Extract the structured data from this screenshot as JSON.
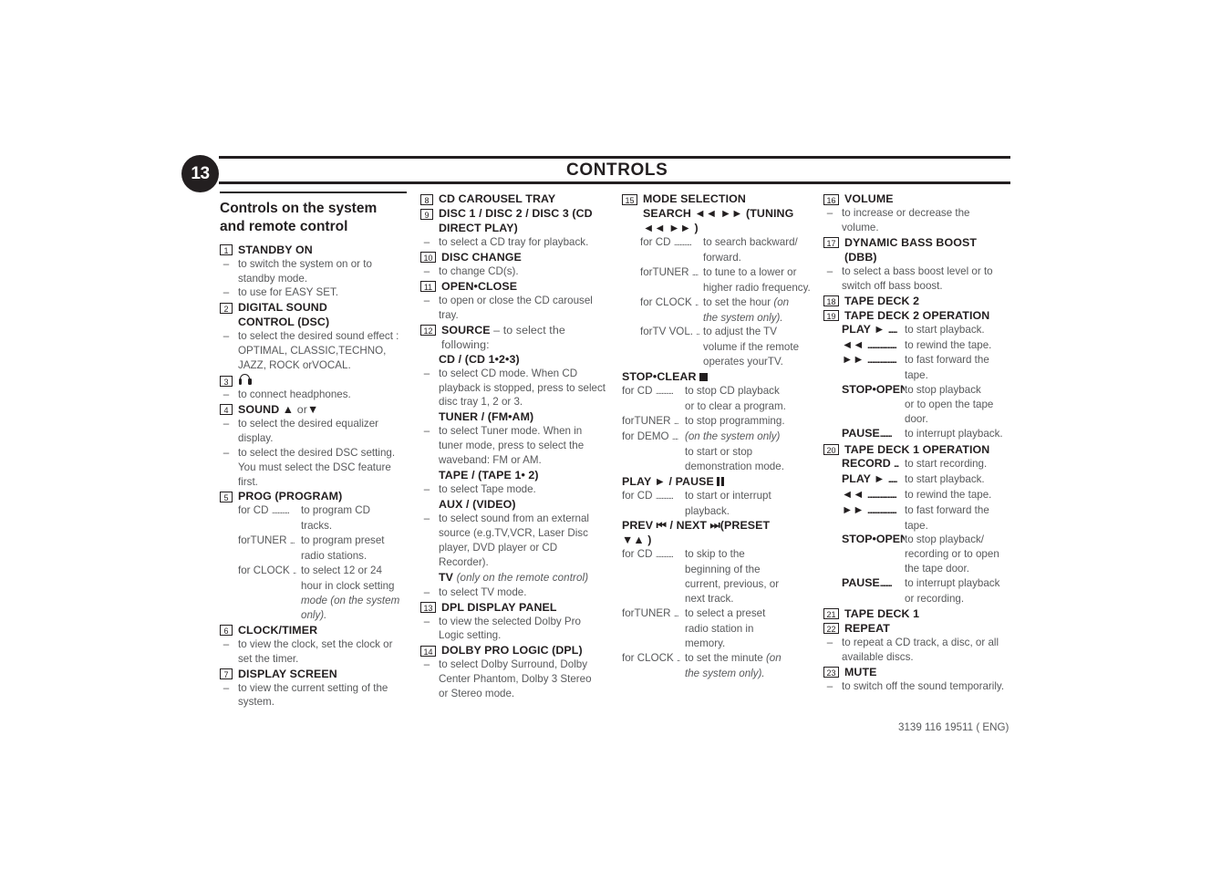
{
  "page": {
    "number": "13",
    "header_title": "CONTROLS",
    "footer_code": "3139 116 19511 ( ENG)"
  },
  "column1": {
    "section_title_line1": "Controls on the system",
    "section_title_line2": "and remote control",
    "items": [
      {
        "num": "1",
        "label": "STANDBY ON",
        "bullets": [
          [
            "to switch the system on or to",
            "standby mode."
          ],
          [
            "to use for EASY SET."
          ]
        ]
      },
      {
        "num": "2",
        "label_line1": "DIGITAL SOUND",
        "label_line2": "CONTROL  (DSC)",
        "bullets": [
          [
            "to select the desired sound effect :",
            "OPTIMAL, CLASSIC,TECHNO,",
            "JAZZ, ROCK orVOCAL."
          ]
        ]
      },
      {
        "num": "3",
        "label_icon": "headphones-icon",
        "bullets": [
          [
            "to connect headphones."
          ]
        ]
      },
      {
        "num": "4",
        "label": "SOUND",
        "label_suffix_up": "▲",
        "label_suffix_or": "or",
        "label_suffix_down": "▼",
        "bullets": [
          [
            "to select the desired equalizer",
            "display."
          ],
          [
            "to select the desired DSC setting.",
            "You must select the DSC feature",
            "first."
          ]
        ]
      },
      {
        "num": "5",
        "label": "PROG (PROGRAM)",
        "leaders": [
          {
            "key": "for CD",
            "dots": "............",
            "lines": [
              "to program CD",
              "tracks."
            ]
          },
          {
            "key": "forTUNER",
            "dots": "...",
            "lines": [
              "to program preset",
              "radio stations."
            ]
          },
          {
            "key": "for CLOCK",
            "dots": "..",
            "lines": [
              "to select 12 or 24",
              "hour in clock setting"
            ],
            "italic_lines": [
              "mode (on the system",
              "only)."
            ]
          }
        ]
      },
      {
        "num": "6",
        "label": "CLOCK/TIMER",
        "bullets": [
          [
            "to view the clock, set the clock or",
            "set the timer."
          ]
        ]
      },
      {
        "num": "7",
        "label": "DISPLAY SCREEN",
        "bullets": [
          [
            "to view the current setting of the",
            "system."
          ]
        ]
      }
    ]
  },
  "column2": {
    "items": [
      {
        "num": "8",
        "label": "CD CAROUSEL TRAY"
      },
      {
        "num": "9",
        "label_line1": "DISC 1 / DISC 2 / DISC 3 (CD",
        "label_line2": "DIRECT PLAY)",
        "bullets": [
          [
            "to select a CD tray for playback."
          ]
        ]
      },
      {
        "num": "10",
        "label": "DISC CHANGE",
        "bullets": [
          [
            "to change CD(s)."
          ]
        ]
      },
      {
        "num": "11",
        "label": "OPEN•CLOSE",
        "bullets": [
          [
            "to open or close the CD carousel",
            "tray."
          ]
        ]
      },
      {
        "num": "12",
        "label": "SOURCE",
        "label_tail": "– to select the",
        "label_tail2": "following:",
        "subs": [
          {
            "sublabel": "CD / (CD 1•2•3)",
            "bullets": [
              [
                "to select CD mode. When CD",
                "playback is stopped, press to select",
                "disc tray 1, 2 or 3."
              ]
            ]
          },
          {
            "sublabel": "TUNER / (FM•AM)",
            "bullets": [
              [
                "to select Tuner mode. When in",
                "tuner mode, press to select the",
                "waveband: FM or AM."
              ]
            ]
          },
          {
            "sublabel": "TAPE / (TAPE 1• 2)",
            "bullets": [
              [
                "to select Tape mode."
              ]
            ]
          },
          {
            "sublabel": "AUX / (VIDEO)",
            "bullets": [
              [
                "to select sound from an external",
                "source (e.g.TV,VCR, Laser Disc",
                "player, DVD player or CD",
                "Recorder)."
              ]
            ]
          },
          {
            "sublabel": "TV",
            "sublabel_italic": "(only on the remote control)",
            "bullets": [
              [
                "to select TV mode."
              ]
            ]
          }
        ]
      },
      {
        "num": "13",
        "label": "DPL DISPLAY PANEL",
        "bullets": [
          [
            "to view the selected Dolby Pro",
            "Logic setting."
          ]
        ]
      },
      {
        "num": "14",
        "label": "DOLBY PRO LOGIC (DPL)",
        "bullets": [
          [
            "to select Dolby Surround, Dolby",
            "Center Phantom, Dolby 3 Stereo",
            "or Stereo mode."
          ]
        ]
      }
    ]
  },
  "column3": {
    "items": [
      {
        "num": "15",
        "label": "MODE SELECTION",
        "label_line2": "SEARCH ◄◄ ►►  (TUNING",
        "label_line3": "◄◄ ►► )",
        "leaders": [
          {
            "key": "for CD",
            "dots": "............",
            "lines": [
              "to search backward/",
              "forward."
            ]
          },
          {
            "key": "forTUNER",
            "dots": "....",
            "lines": [
              "to tune to a lower or",
              "higher radio frequency."
            ]
          },
          {
            "key": "for CLOCK",
            "dots": "..",
            "lines": [
              "to set the hour "
            ],
            "italic_tail": "(on",
            "italic_lines": [
              "the system only)."
            ]
          },
          {
            "key": "forTV VOL.",
            "dots": "..",
            "lines": [
              "to adjust the TV",
              "volume if the remote",
              "operates yourTV."
            ]
          }
        ]
      },
      {
        "sublabel": "STOP•CLEAR",
        "sublabel_icon": "stop-square-icon",
        "leaders": [
          {
            "key": "for CD",
            "dots": "............",
            "lines": [
              "to stop CD playback",
              "or to clear a program."
            ]
          },
          {
            "key": "forTUNER",
            "dots": "...",
            "lines": [
              "to stop programming."
            ]
          },
          {
            "key": "for DEMO",
            "dots": "....",
            "italic_first": "(on the system only)",
            "lines": [
              "to start or stop",
              "demonstration mode."
            ]
          }
        ]
      },
      {
        "sublabel_parts": [
          "PLAY",
          "►",
          "/ PAUSE",
          "pause-icon"
        ],
        "sublabel": "PLAY ► / PAUSE",
        "leaders": [
          {
            "key": "for CD",
            "dots": "............",
            "lines": [
              "to start or interrupt",
              "playback."
            ]
          }
        ]
      },
      {
        "sublabel": "PREV ⏮ / NEXT ⏭(PRESET",
        "sublabel_line2": "▼▲ )",
        "leaders": [
          {
            "key": "for CD",
            "dots": "............",
            "lines": [
              "to skip to the",
              "beginning of the",
              "current, previous, or",
              "next track."
            ]
          },
          {
            "key": "forTUNER",
            "dots": "...",
            "lines": [
              "to select a preset",
              "radio station in",
              "memory."
            ]
          },
          {
            "key": "for CLOCK",
            "dots": "..",
            "lines": [
              "to set the minute "
            ],
            "italic_tail": "(on",
            "italic_lines": [
              "the system only)."
            ]
          }
        ]
      }
    ]
  },
  "column4": {
    "items": [
      {
        "num": "16",
        "label": "VOLUME",
        "bullets": [
          [
            "to increase or decrease the",
            "volume."
          ]
        ]
      },
      {
        "num": "17",
        "label_line1": "DYNAMIC BASS BOOST",
        "label_line2": "(DBB)",
        "bullets": [
          [
            "to select a bass boost level or to",
            "switch off bass boost."
          ]
        ]
      },
      {
        "num": "18",
        "label": "TAPE DECK 2"
      },
      {
        "num": "19",
        "label": "TAPE DECK 2 OPERATION",
        "leaders": [
          {
            "key": "PLAY ►",
            "dots": "......",
            "bold": true,
            "lines": [
              "to start playback."
            ]
          },
          {
            "key": "◄◄",
            "dots": "....................",
            "bold": true,
            "lines": [
              "to rewind the tape."
            ]
          },
          {
            "key": "►►",
            "dots": "....................",
            "bold": true,
            "lines": [
              "to fast forward the",
              "tape."
            ]
          },
          {
            "key": "STOP•OPEN",
            "dots": "…",
            "bold": true,
            "lines": [
              "to stop playback",
              "or to open the tape",
              "door."
            ]
          },
          {
            "key": "PAUSE",
            "dots": "........",
            "bold": true,
            "lines": [
              "to interrupt playback."
            ]
          }
        ]
      },
      {
        "num": "20",
        "label": "TAPE DECK 1 OPERATION",
        "leaders": [
          {
            "key": "RECORD",
            "dots": "...",
            "bold": true,
            "lines": [
              "to start recording."
            ]
          },
          {
            "key": "PLAY ►",
            "dots": "......",
            "bold": true,
            "lines": [
              "to start playback."
            ]
          },
          {
            "key": "◄◄",
            "dots": "....................",
            "bold": true,
            "lines": [
              "to rewind the tape."
            ]
          },
          {
            "key": "►►",
            "dots": "....................",
            "bold": true,
            "lines": [
              "to fast forward the",
              "tape."
            ]
          },
          {
            "key": "STOP•OPEN",
            "dots": "…",
            "bold": true,
            "lines": [
              "to stop playback/",
              "recording or to open",
              "the tape door."
            ]
          },
          {
            "key": "PAUSE",
            "dots": "........",
            "bold": true,
            "lines": [
              "to interrupt playback",
              "or recording."
            ]
          }
        ]
      },
      {
        "num": "21",
        "label": "TAPE DECK 1"
      },
      {
        "num": "22",
        "label": "REPEAT",
        "bullets": [
          [
            "to repeat a CD track, a disc, or all",
            "available discs."
          ]
        ]
      },
      {
        "num": "23",
        "label": "MUTE",
        "bullets": [
          [
            "to switch off the sound temporarily."
          ]
        ]
      }
    ]
  }
}
